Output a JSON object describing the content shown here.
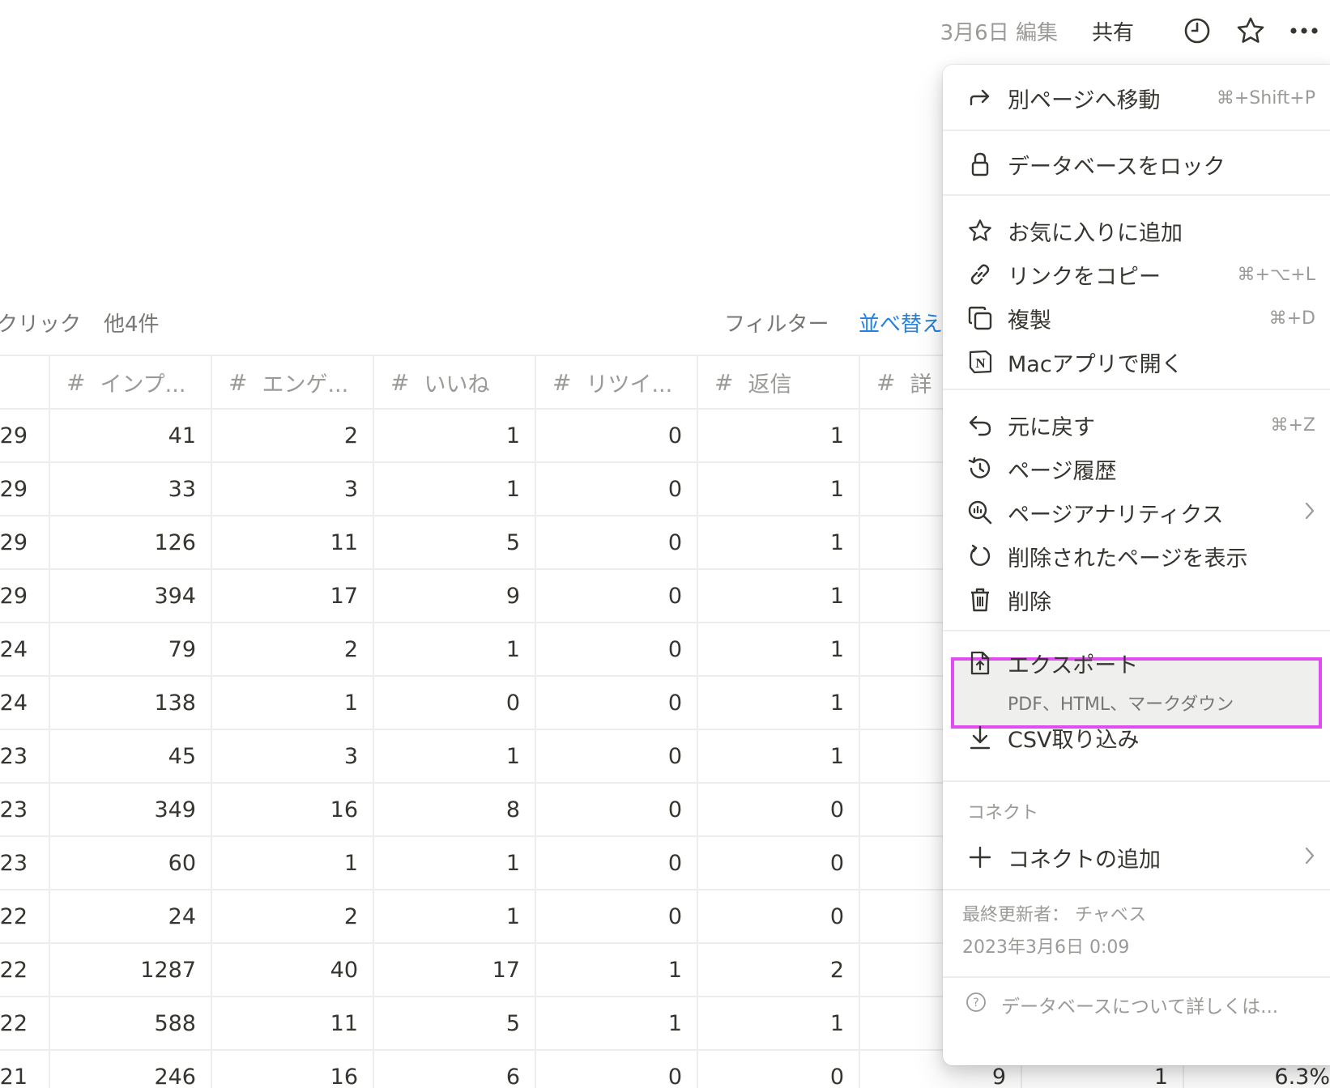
{
  "topbar": {
    "edited": "3月6日 編集",
    "share": "共有",
    "icons": [
      "clock-icon",
      "star-icon",
      "more-icon"
    ]
  },
  "viewbar": {
    "click_partial": "クリック",
    "others": "他4件",
    "filter": "フィルター",
    "sort": "並べ替え"
  },
  "table": {
    "headers": [
      "インプ...",
      "エンゲ...",
      "いいね",
      "リツイ...",
      "返信",
      "詳"
    ],
    "rows": [
      {
        "date": "29",
        "v": [
          "41",
          "2",
          "1",
          "0",
          "1"
        ]
      },
      {
        "date": "29",
        "v": [
          "33",
          "3",
          "1",
          "0",
          "1"
        ]
      },
      {
        "date": "29",
        "v": [
          "126",
          "11",
          "5",
          "0",
          "1"
        ]
      },
      {
        "date": "29",
        "v": [
          "394",
          "17",
          "9",
          "0",
          "1"
        ]
      },
      {
        "date": "24",
        "v": [
          "79",
          "2",
          "1",
          "0",
          "1"
        ]
      },
      {
        "date": "24",
        "v": [
          "138",
          "1",
          "0",
          "0",
          "1"
        ]
      },
      {
        "date": "23",
        "v": [
          "45",
          "3",
          "1",
          "0",
          "1"
        ]
      },
      {
        "date": "23",
        "v": [
          "349",
          "16",
          "8",
          "0",
          "0"
        ]
      },
      {
        "date": "23",
        "v": [
          "60",
          "1",
          "1",
          "0",
          "0"
        ]
      },
      {
        "date": "22",
        "v": [
          "24",
          "2",
          "1",
          "0",
          "0"
        ]
      },
      {
        "date": "22",
        "v": [
          "1287",
          "40",
          "17",
          "1",
          "2"
        ]
      },
      {
        "date": "22",
        "v": [
          "588",
          "11",
          "5",
          "1",
          "1"
        ]
      },
      {
        "date": "21",
        "v": [
          "246",
          "16",
          "6",
          "0",
          "0"
        ],
        "extra": [
          "9",
          "1",
          "6.3%"
        ]
      }
    ]
  },
  "menu": {
    "move": {
      "label": "別ページへ移動",
      "shortcut": "⌘+Shift+P"
    },
    "lock": {
      "label": "データベースをロック"
    },
    "favorite": {
      "label": "お気に入りに追加"
    },
    "copy_link": {
      "label": "リンクをコピー",
      "shortcut": "⌘+⌥+L"
    },
    "duplicate": {
      "label": "複製",
      "shortcut": "⌘+D"
    },
    "open_mac": {
      "label": "Macアプリで開く"
    },
    "undo": {
      "label": "元に戻す",
      "shortcut": "⌘+Z"
    },
    "history": {
      "label": "ページ履歴"
    },
    "analytics": {
      "label": "ページアナリティクス"
    },
    "deleted": {
      "label": "削除されたページを表示"
    },
    "delete": {
      "label": "削除"
    },
    "export": {
      "label": "エクスポート",
      "sub": "PDF、HTML、マークダウン"
    },
    "csv": {
      "label": "CSV取り込み"
    },
    "connect_section": "コネクト",
    "add_connect": {
      "label": "コネクトの追加"
    },
    "last_edited_by": "最終更新者： チャベス",
    "last_edited_at": "2023年3月6日 0:09",
    "help": "データベースについて詳しくは..."
  },
  "colors": {
    "highlight_border": "#e14cf0",
    "sort_link": "#2383e2"
  }
}
